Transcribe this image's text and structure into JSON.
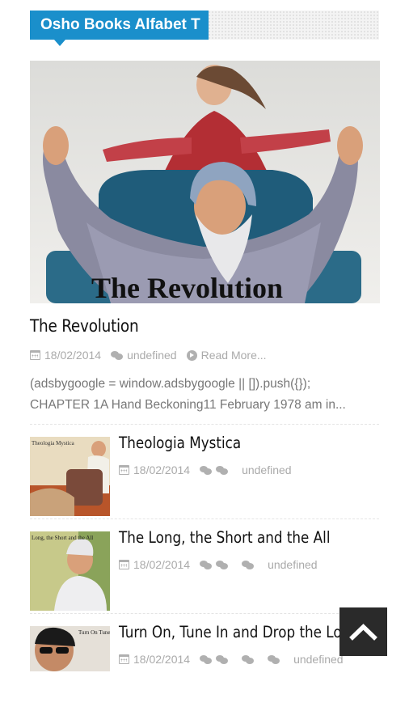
{
  "section": {
    "title": "Osho Books Alfabet T"
  },
  "featured": {
    "image_caption": "The Revolution",
    "title": "The Revolution",
    "date": "18/02/2014",
    "comments": "undefined",
    "read_more": "Read More...",
    "excerpt_line1": "(adsbygoogle = window.adsbygoogle || []).push({});",
    "excerpt_line2": "CHAPTER 1A Hand Beckoning11 February 1978 am in..."
  },
  "posts": [
    {
      "title": "Theologia Mystica",
      "date": "18/02/2014",
      "comments": "undefined",
      "thumb_caption": "Theologia Mystica"
    },
    {
      "title": "The Long, the Short and the All",
      "date": "18/02/2014",
      "comments": "undefined",
      "thumb_caption": "Long, the Short and the All"
    },
    {
      "title": "Turn On, Tune In and Drop the Lot",
      "date": "18/02/2014",
      "comments": "undefined",
      "thumb_caption": "Turn On Tune In Drop the"
    }
  ],
  "icons": {
    "calendar": "calendar-icon",
    "comment": "comments-icon",
    "read_more": "arrow-circle-right-icon",
    "back_to_top": "chevron-up-icon"
  },
  "colors": {
    "accent": "#1a8fcb",
    "meta": "#aaaaaa",
    "back_to_top_bg": "#2a2a2a"
  }
}
